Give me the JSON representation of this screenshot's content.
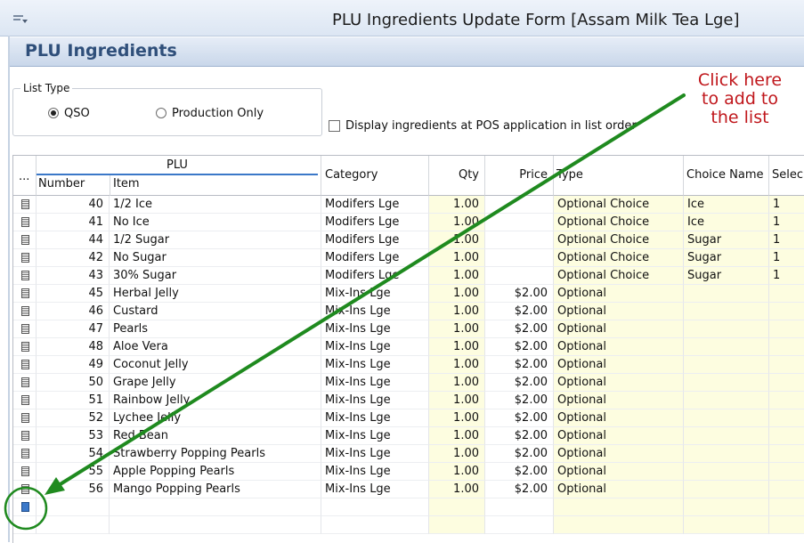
{
  "window": {
    "title": "PLU Ingredients Update Form [Assam Milk Tea Lge]"
  },
  "header": {
    "title": "PLU Ingredients"
  },
  "list_type": {
    "legend": "List Type",
    "options": [
      {
        "label": "QSO",
        "selected": true
      },
      {
        "label": "Production Only",
        "selected": false
      }
    ]
  },
  "display_checkbox": {
    "label": "Display ingredients at POS application in list order",
    "checked": false
  },
  "grid": {
    "ellipsis": "...",
    "plu_group": "PLU",
    "columns": [
      "Number",
      "Item",
      "Category",
      "Qty",
      "Price",
      "Type",
      "Choice Name",
      "Selec"
    ],
    "rows": [
      {
        "number": "40",
        "item": "1/2 Ice",
        "category": "Modifers Lge",
        "qty": "1.00",
        "price": "",
        "type": "Optional Choice",
        "choice": "Ice",
        "select": "1"
      },
      {
        "number": "41",
        "item": "No Ice",
        "category": "Modifers Lge",
        "qty": "1.00",
        "price": "",
        "type": "Optional Choice",
        "choice": "Ice",
        "select": "1"
      },
      {
        "number": "44",
        "item": "1/2 Sugar",
        "category": "Modifers Lge",
        "qty": "1.00",
        "price": "",
        "type": "Optional Choice",
        "choice": "Sugar",
        "select": "1"
      },
      {
        "number": "42",
        "item": "No Sugar",
        "category": "Modifers Lge",
        "qty": "1.00",
        "price": "",
        "type": "Optional Choice",
        "choice": "Sugar",
        "select": "1"
      },
      {
        "number": "43",
        "item": "30% Sugar",
        "category": "Modifers Lge",
        "qty": "1.00",
        "price": "",
        "type": "Optional Choice",
        "choice": "Sugar",
        "select": "1"
      },
      {
        "number": "45",
        "item": "Herbal Jelly",
        "category": "Mix-Ins Lge",
        "qty": "1.00",
        "price": "$2.00",
        "type": "Optional",
        "choice": "",
        "select": ""
      },
      {
        "number": "46",
        "item": "Custard",
        "category": "Mix-Ins Lge",
        "qty": "1.00",
        "price": "$2.00",
        "type": "Optional",
        "choice": "",
        "select": ""
      },
      {
        "number": "47",
        "item": "Pearls",
        "category": "Mix-Ins Lge",
        "qty": "1.00",
        "price": "$2.00",
        "type": "Optional",
        "choice": "",
        "select": ""
      },
      {
        "number": "48",
        "item": "Aloe Vera",
        "category": "Mix-Ins Lge",
        "qty": "1.00",
        "price": "$2.00",
        "type": "Optional",
        "choice": "",
        "select": ""
      },
      {
        "number": "49",
        "item": "Coconut Jelly",
        "category": "Mix-Ins Lge",
        "qty": "1.00",
        "price": "$2.00",
        "type": "Optional",
        "choice": "",
        "select": ""
      },
      {
        "number": "50",
        "item": "Grape Jelly",
        "category": "Mix-Ins Lge",
        "qty": "1.00",
        "price": "$2.00",
        "type": "Optional",
        "choice": "",
        "select": ""
      },
      {
        "number": "51",
        "item": "Rainbow Jelly",
        "category": "Mix-Ins Lge",
        "qty": "1.00",
        "price": "$2.00",
        "type": "Optional",
        "choice": "",
        "select": ""
      },
      {
        "number": "52",
        "item": "Lychee Jelly",
        "category": "Mix-Ins Lge",
        "qty": "1.00",
        "price": "$2.00",
        "type": "Optional",
        "choice": "",
        "select": ""
      },
      {
        "number": "53",
        "item": "Red Bean",
        "category": "Mix-Ins Lge",
        "qty": "1.00",
        "price": "$2.00",
        "type": "Optional",
        "choice": "",
        "select": ""
      },
      {
        "number": "54",
        "item": "Strawberry Popping Pearls",
        "category": "Mix-Ins Lge",
        "qty": "1.00",
        "price": "$2.00",
        "type": "Optional",
        "choice": "",
        "select": ""
      },
      {
        "number": "55",
        "item": "Apple Popping Pearls",
        "category": "Mix-Ins Lge",
        "qty": "1.00",
        "price": "$2.00",
        "type": "Optional",
        "choice": "",
        "select": ""
      },
      {
        "number": "56",
        "item": "Mango Popping Pearls",
        "category": "Mix-Ins Lge",
        "qty": "1.00",
        "price": "$2.00",
        "type": "Optional",
        "choice": "",
        "select": ""
      }
    ]
  },
  "annotation": {
    "lines": [
      "Click here",
      "to add to",
      "the list"
    ],
    "color": "#c0171c",
    "arrow_color": "#1f8a1f"
  }
}
